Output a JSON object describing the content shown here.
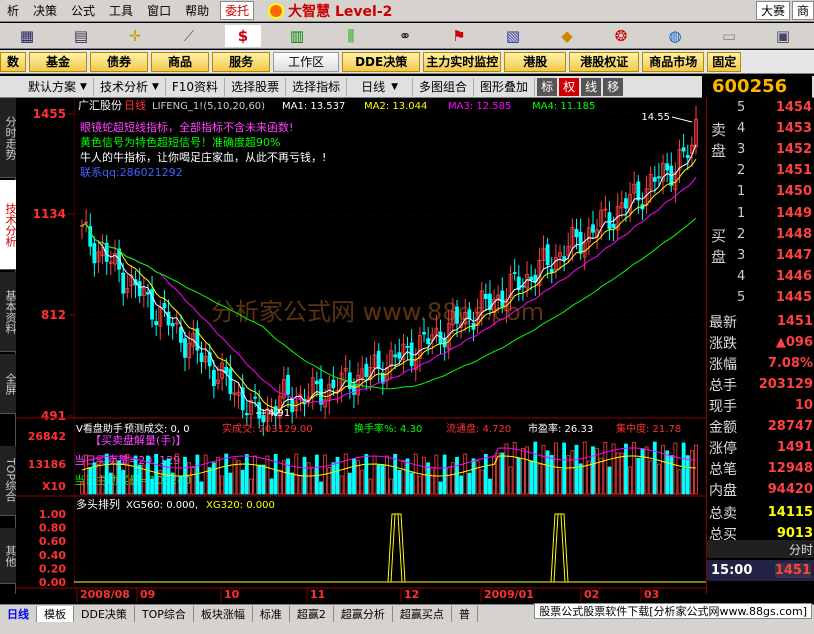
{
  "menu": {
    "items": [
      "析",
      "决策",
      "公式",
      "工具",
      "窗口",
      "帮助"
    ],
    "trade": "委托",
    "brand": "大智慧 Level-2",
    "right1": "大赛",
    "right2": "商"
  },
  "shortcuts": [
    "数",
    "基金",
    "债券",
    "商品",
    "服务",
    "工作区",
    "DDE决策",
    "主力实时监控",
    "港股",
    "港股权证",
    "商品市场",
    "固定"
  ],
  "chartbar": {
    "items": [
      "默认方案",
      "技术分析",
      "F10资料",
      "选择股票",
      "选择指标",
      "日线",
      "多图组合",
      "图形叠加"
    ],
    "buttons": [
      "标",
      "权",
      "线",
      "移"
    ]
  },
  "stock": {
    "code": "600256",
    "name": "广汇股份",
    "period": "日线",
    "indicator": "LIFENG_1!(5,10,20,60)"
  },
  "ma": [
    {
      "label": "MA1",
      "value": "13.537",
      "color": "#ffffff"
    },
    {
      "label": "MA2",
      "value": "13.044",
      "color": "#ffff00"
    },
    {
      "label": "MA3",
      "value": "12.585",
      "color": "#ff00ff"
    },
    {
      "label": "MA4",
      "value": "11.185",
      "color": "#00ff00"
    }
  ],
  "notes": [
    {
      "text": "眼镜蛇超短线指标，全部指标不含未来函数!",
      "color": "#ff40ff"
    },
    {
      "text": "黄色信号为特色超短信号！准确度超90%",
      "color": "#00ff00"
    },
    {
      "text": "牛人的牛指标，让你喝足庄家血，从此不再亏钱，!",
      "color": "#ffffff"
    },
    {
      "text": "联系qq:286021292",
      "color": "#4060ff"
    }
  ],
  "price_axis": [
    "1455",
    "1134",
    "812",
    "491"
  ],
  "annotations": {
    "high": "14.55",
    "low": "4.91"
  },
  "watermark": "分析家公式网 www.88gs.com",
  "volume": {
    "title": "V看盘助手",
    "predict_label": "预测成交:",
    "predict_value": "0, 0",
    "deal_label": "实成交:",
    "deal_value": "203129.00",
    "turnover_label": "换手率%",
    "turnover_value": "4.30",
    "float_label": "流通盘:",
    "float_value": "4.720",
    "pe_label": "市盈率:",
    "pe_value": "26.33",
    "conc_label": "集中度:",
    "conc_value": "21.78",
    "axis": [
      "26842",
      "13186",
      "X10"
    ],
    "legend1": "【买卖盘解量(手)】",
    "legend2": "当日买卖量=203129",
    "legend3": "当日主动买量=105240"
  },
  "signal": {
    "title": "多头排列",
    "xg560_label": "XG560:",
    "xg560_value": "0.000",
    "xg320_label": "XG320:",
    "xg320_value": "0.000",
    "axis": [
      "1.00",
      "0.80",
      "0.60",
      "0.40",
      "0.20",
      "0.00"
    ]
  },
  "dates": [
    "2008/08",
    "09",
    "10",
    "11",
    "12",
    "2009/01",
    "02",
    "03"
  ],
  "sidetabs": [
    "分时走势",
    "技术分析",
    "基本资料",
    "全屏",
    "TOP综合",
    "其他"
  ],
  "orderbook": {
    "sell_label": "卖盘",
    "buy_label": "买盘",
    "levels": [
      "5",
      "4",
      "3",
      "2",
      "1"
    ],
    "sell_prices": [
      "1454",
      "1453",
      "1452",
      "1451",
      "1450"
    ],
    "buy_prices": [
      "1449",
      "1448",
      "1447",
      "1446",
      "1445"
    ]
  },
  "quotes": [
    {
      "k": "最新",
      "v": "1451"
    },
    {
      "k": "涨跌",
      "v": "▲096"
    },
    {
      "k": "涨幅",
      "v": "7.08%"
    },
    {
      "k": "总手",
      "v": "203129"
    },
    {
      "k": "现手",
      "v": "10"
    },
    {
      "k": "金额",
      "v": "28747"
    },
    {
      "k": "涨停",
      "v": "1491"
    },
    {
      "k": "总笔",
      "v": "12948"
    },
    {
      "k": "内盘",
      "v": "94420"
    },
    {
      "k": "总卖",
      "v": "14115"
    },
    {
      "k": "总买",
      "v": "9013"
    }
  ],
  "time_header": "分时",
  "time": {
    "t": "15:00",
    "p": "1451"
  },
  "bottomtabs": [
    "日线",
    "模板",
    "DDE决策",
    "TOP综合",
    "板块涨幅",
    "标准",
    "超赢2",
    "超赢分析",
    "超赢买点",
    "普"
  ],
  "footer_ad": "股票公式股票软件下载[分析家公式网www.88gs.com]",
  "colors": {
    "up": "#ff4040",
    "down": "#00ffff",
    "ma1": "#ffffff",
    "ma2": "#ffff00",
    "ma3": "#ff00ff",
    "ma4": "#00ff00"
  }
}
